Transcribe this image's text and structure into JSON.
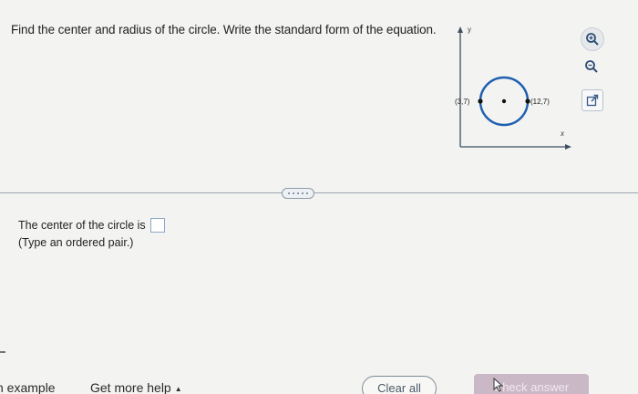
{
  "question": {
    "text": "Find the center and radius of the circle. Write the standard form of the equation."
  },
  "graph": {
    "y_axis_label": "y",
    "x_axis_label": "x",
    "left_point_label": "(3,7)",
    "right_point_label": "(12,7)"
  },
  "tools": {
    "zoom_in_icon": "zoom-in-icon",
    "zoom_out_icon": "zoom-out-icon",
    "popout_icon": "external-link-icon"
  },
  "answer": {
    "prompt": "The center of the circle is",
    "hint": "(Type an ordered pair.)"
  },
  "footer": {
    "example_label": "n example",
    "help_label": "Get more help",
    "help_caret": "▲",
    "clear_label": "Clear all",
    "check_label": "Check answer"
  },
  "colors": {
    "circle": "#1f5fb0",
    "axis": "#3d4f63",
    "check_button": "#cbb8c6",
    "divider": "#9aa5b0"
  }
}
